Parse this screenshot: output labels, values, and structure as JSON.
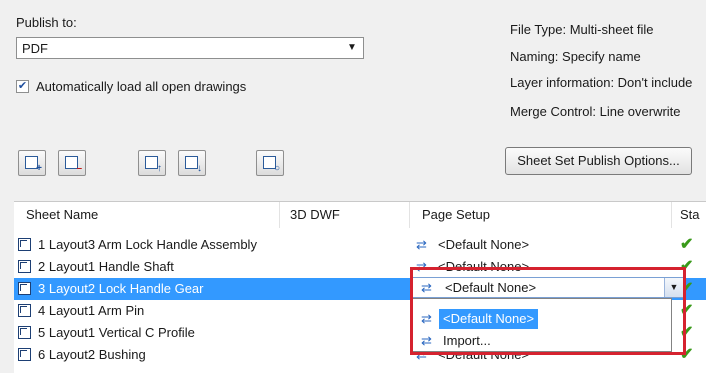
{
  "publish": {
    "label": "Publish to:",
    "selected": "PDF",
    "autoload_label": "Automatically load all open drawings",
    "autoload_checked": true
  },
  "toolbar": {
    "buttons": [
      "add-sheets-icon",
      "remove-sheets-icon",
      "move-up-icon",
      "move-down-icon",
      "preview-icon"
    ]
  },
  "options": {
    "file_type": "File Type:  Multi-sheet file",
    "naming": "Naming:  Specify name",
    "layer": "Layer information:  Don't include",
    "merge": "Merge Control:  Line overwrite",
    "button": "Sheet Set Publish Options..."
  },
  "table": {
    "headers": [
      "Sheet Name",
      "3D DWF",
      "Page Setup",
      "Sta"
    ],
    "rows": [
      {
        "name": "1 Layout3 Arm Lock Handle Assembly",
        "setup": "<Default None>"
      },
      {
        "name": "2 Layout1 Handle Shaft",
        "setup": "<Default None>"
      },
      {
        "name": "3 Layout2 Lock Handle Gear",
        "setup": "<Default None>"
      },
      {
        "name": "4 Layout1 Arm Pin",
        "setup": "<Default None>"
      },
      {
        "name": "5 Layout1 Vertical C Profile",
        "setup": "<Default None>"
      },
      {
        "name": "6 Layout2 Bushing",
        "setup": "<Default None>"
      }
    ],
    "selected_row": 3
  },
  "page_setup_dropdown": {
    "value": "<Default None>",
    "options": [
      "<Default None>",
      "Import..."
    ]
  },
  "colors": {
    "selection": "#3399ff",
    "highlight_box": "#d5222f",
    "status_check": "#3a9a1a"
  }
}
